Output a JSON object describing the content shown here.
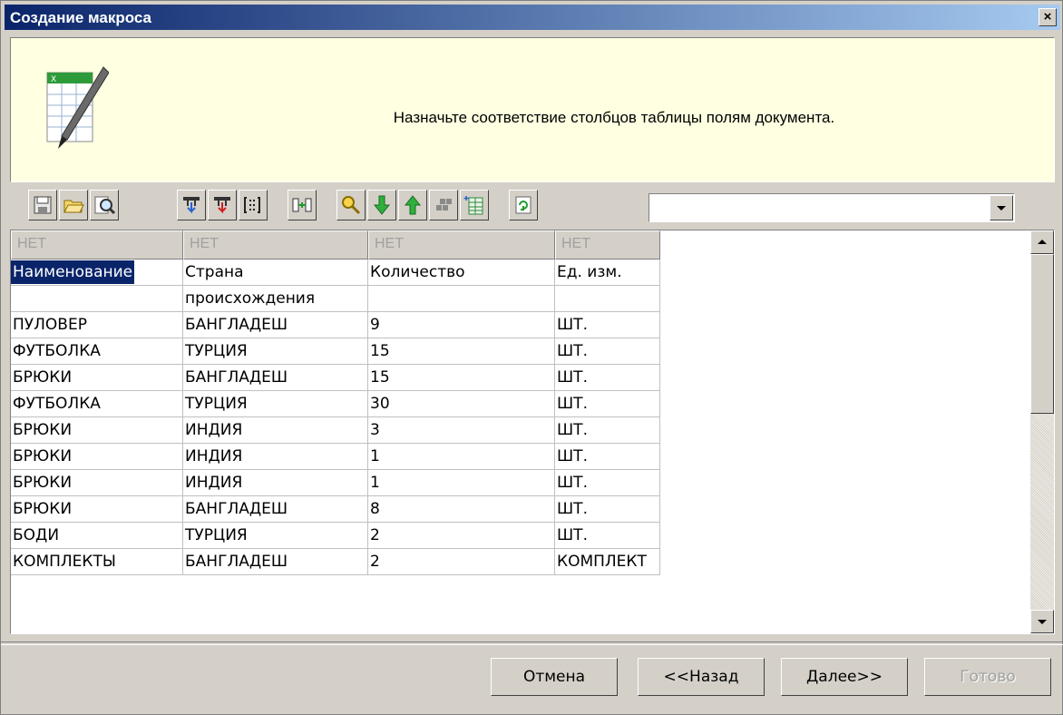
{
  "window": {
    "title": "Создание макроса",
    "close_label": "×"
  },
  "header": {
    "message": "Назначьте соответствие столбцов таблицы полям документа."
  },
  "toolbar": {
    "buttons": [
      {
        "icon": "save-icon"
      },
      {
        "icon": "open-folder-icon"
      },
      {
        "icon": "preview-icon"
      },
      {
        "icon": "import-columns-icon"
      },
      {
        "icon": "export-columns-icon"
      },
      {
        "icon": "column-format-icon"
      },
      {
        "icon": "merge-columns-icon"
      },
      {
        "icon": "find-icon"
      },
      {
        "icon": "move-down-icon"
      },
      {
        "icon": "move-up-icon"
      },
      {
        "icon": "group-icon"
      },
      {
        "icon": "add-table-icon"
      },
      {
        "icon": "refresh-icon"
      }
    ],
    "combo_value": ""
  },
  "grid": {
    "headers": [
      "НЕТ",
      "НЕТ",
      "НЕТ",
      "НЕТ"
    ],
    "rows": [
      [
        "Наименование",
        "Страна",
        "Количество",
        "Ед. изм."
      ],
      [
        "",
        "происхождения",
        "",
        ""
      ],
      [
        "ПУЛОВЕР",
        "БАНГЛАДЕШ",
        "9",
        "ШТ."
      ],
      [
        "ФУТБОЛКА",
        "ТУРЦИЯ",
        "15",
        "ШТ."
      ],
      [
        "БРЮКИ",
        "БАНГЛАДЕШ",
        "15",
        "ШТ."
      ],
      [
        "ФУТБОЛКА",
        "ТУРЦИЯ",
        "30",
        "ШТ."
      ],
      [
        "БРЮКИ",
        "ИНДИЯ",
        "3",
        "ШТ."
      ],
      [
        "БРЮКИ",
        "ИНДИЯ",
        "1",
        "ШТ."
      ],
      [
        "БРЮКИ",
        "ИНДИЯ",
        "1",
        "ШТ."
      ],
      [
        "БРЮКИ",
        "БАНГЛАДЕШ",
        "8",
        "ШТ."
      ],
      [
        "БОДИ",
        "ТУРЦИЯ",
        "2",
        "ШТ."
      ],
      [
        "КОМПЛЕКТЫ",
        "БАНГЛАДЕШ",
        "2",
        "КОМПЛЕКТ"
      ]
    ]
  },
  "footer": {
    "cancel": "Отмена",
    "back": "<<Назад",
    "next": "Далее>>",
    "finish": "Готово"
  }
}
